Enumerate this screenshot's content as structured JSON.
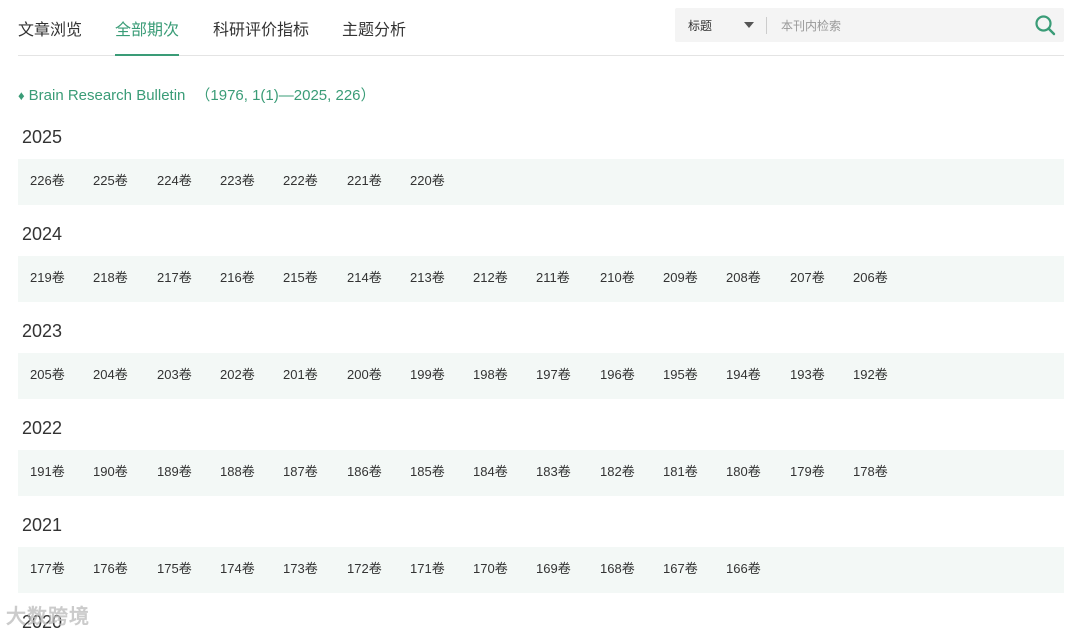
{
  "tabs": [
    "文章浏览",
    "全部期次",
    "科研评价指标",
    "主题分析"
  ],
  "active_tab": 1,
  "search": {
    "field": "标题",
    "placeholder": "本刊内检索"
  },
  "journal": {
    "name": "Brain Research Bulletin",
    "range": "（1976, 1(1)—2025, 226）"
  },
  "years": [
    {
      "year": "2025",
      "volumes": [
        "226卷",
        "225卷",
        "224卷",
        "223卷",
        "222卷",
        "221卷",
        "220卷"
      ]
    },
    {
      "year": "2024",
      "volumes": [
        "219卷",
        "218卷",
        "217卷",
        "216卷",
        "215卷",
        "214卷",
        "213卷",
        "212卷",
        "211卷",
        "210卷",
        "209卷",
        "208卷",
        "207卷",
        "206卷"
      ]
    },
    {
      "year": "2023",
      "volumes": [
        "205卷",
        "204卷",
        "203卷",
        "202卷",
        "201卷",
        "200卷",
        "199卷",
        "198卷",
        "197卷",
        "196卷",
        "195卷",
        "194卷",
        "193卷",
        "192卷"
      ]
    },
    {
      "year": "2022",
      "volumes": [
        "191卷",
        "190卷",
        "189卷",
        "188卷",
        "187卷",
        "186卷",
        "185卷",
        "184卷",
        "183卷",
        "182卷",
        "181卷",
        "180卷",
        "179卷",
        "178卷"
      ]
    },
    {
      "year": "2021",
      "volumes": [
        "177卷",
        "176卷",
        "175卷",
        "174卷",
        "173卷",
        "172卷",
        "171卷",
        "170卷",
        "169卷",
        "168卷",
        "167卷",
        "166卷"
      ]
    },
    {
      "year": "2020",
      "volumes": []
    }
  ],
  "watermark": "大数跨境",
  "colors": {
    "accent": "#3a9c77",
    "row_bg": "#f3f8f6"
  }
}
